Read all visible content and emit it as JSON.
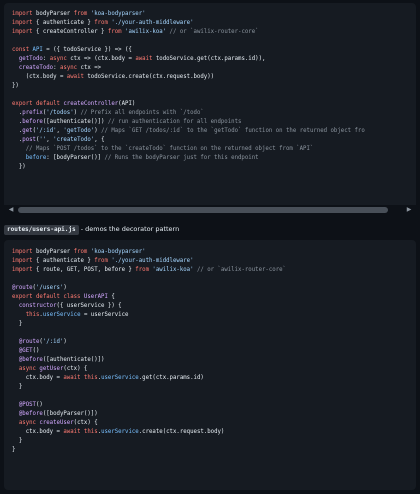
{
  "block1": {
    "lines": [
      [
        [
          "k",
          "import "
        ],
        [
          "t",
          "bodyParser "
        ],
        [
          "k",
          "from "
        ],
        [
          "s",
          "'koa-bodyparser'"
        ]
      ],
      [
        [
          "k",
          "import "
        ],
        [
          "t",
          "{ authenticate } "
        ],
        [
          "k",
          "from "
        ],
        [
          "s",
          "'./your-auth-middleware'"
        ]
      ],
      [
        [
          "k",
          "import "
        ],
        [
          "t",
          "{ createController } "
        ],
        [
          "k",
          "from "
        ],
        [
          "s",
          "'awilix-koa' "
        ],
        [
          "c",
          "// or `awilix-router-core`"
        ]
      ],
      [],
      [
        [
          "k",
          "const "
        ],
        [
          "p",
          "API "
        ],
        [
          "t",
          "= ({ todoService }) => ({"
        ]
      ],
      [
        [
          "t",
          "  "
        ],
        [
          "f",
          "getTodo"
        ],
        [
          "t",
          ": "
        ],
        [
          "k",
          "async "
        ],
        [
          "t",
          "ctx => (ctx.body = "
        ],
        [
          "k",
          "await "
        ],
        [
          "t",
          "todoService.get(ctx.params.id)),"
        ]
      ],
      [
        [
          "t",
          "  "
        ],
        [
          "f",
          "createTodo"
        ],
        [
          "t",
          ": "
        ],
        [
          "k",
          "async "
        ],
        [
          "t",
          "ctx =>"
        ]
      ],
      [
        [
          "t",
          "    (ctx.body = "
        ],
        [
          "k",
          "await "
        ],
        [
          "t",
          "todoService.create(ctx.request.body))"
        ]
      ],
      [
        [
          "t",
          "})"
        ]
      ],
      [],
      [
        [
          "k",
          "export default "
        ],
        [
          "f",
          "createController"
        ],
        [
          "t",
          "(API)"
        ]
      ],
      [
        [
          "t",
          "  ."
        ],
        [
          "f",
          "prefix"
        ],
        [
          "t",
          "("
        ],
        [
          "s",
          "'/todos'"
        ],
        [
          "t",
          ") "
        ],
        [
          "c",
          "// Prefix all endpoints with `/todo`"
        ]
      ],
      [
        [
          "t",
          "  ."
        ],
        [
          "f",
          "before"
        ],
        [
          "t",
          "([authenticate()]) "
        ],
        [
          "c",
          "// run authentication for all endpoints"
        ]
      ],
      [
        [
          "t",
          "  ."
        ],
        [
          "f",
          "get"
        ],
        [
          "t",
          "("
        ],
        [
          "s",
          "'/:id'"
        ],
        [
          "t",
          ", "
        ],
        [
          "s",
          "'getTodo'"
        ],
        [
          "t",
          ") "
        ],
        [
          "c",
          "// Maps `GET /todos/:id` to the `getTodo` function on the returned object fro"
        ]
      ],
      [
        [
          "t",
          "  ."
        ],
        [
          "f",
          "post"
        ],
        [
          "t",
          "("
        ],
        [
          "s",
          "''"
        ],
        [
          "t",
          ", "
        ],
        [
          "s",
          "'createTodo'"
        ],
        [
          "t",
          ", {"
        ]
      ],
      [
        [
          "t",
          "    "
        ],
        [
          "c",
          "// Maps `POST /todos` to the `createTodo` function on the returned object from `API`"
        ]
      ],
      [
        [
          "t",
          "    "
        ],
        [
          "p",
          "before"
        ],
        [
          "t",
          ": [bodyParser()] "
        ],
        [
          "c",
          "// Runs the bodyParser just for this endpoint"
        ]
      ],
      [
        [
          "t",
          "  })"
        ]
      ]
    ]
  },
  "caption": {
    "file": "routes/users-api.js",
    "text": " - demos the decorator pattern"
  },
  "block2": {
    "lines": [
      [
        [
          "k",
          "import "
        ],
        [
          "t",
          "bodyParser "
        ],
        [
          "k",
          "from "
        ],
        [
          "s",
          "'koa-bodyparser'"
        ]
      ],
      [
        [
          "k",
          "import "
        ],
        [
          "t",
          "{ authenticate } "
        ],
        [
          "k",
          "from "
        ],
        [
          "s",
          "'./your-auth-middleware'"
        ]
      ],
      [
        [
          "k",
          "import "
        ],
        [
          "t",
          "{ route, GET, POST, before } "
        ],
        [
          "k",
          "from "
        ],
        [
          "s",
          "'awilix-koa' "
        ],
        [
          "c",
          "// or `awilix-router-core`"
        ]
      ],
      [],
      [
        [
          "f",
          "@route"
        ],
        [
          "t",
          "("
        ],
        [
          "s",
          "'/users'"
        ],
        [
          "t",
          ")"
        ]
      ],
      [
        [
          "k",
          "export default class "
        ],
        [
          "f",
          "UserAPI "
        ],
        [
          "t",
          "{"
        ]
      ],
      [
        [
          "t",
          "  "
        ],
        [
          "f",
          "constructor"
        ],
        [
          "t",
          "({ userService }) {"
        ]
      ],
      [
        [
          "t",
          "    "
        ],
        [
          "k",
          "this"
        ],
        [
          "t",
          "."
        ],
        [
          "p",
          "userService "
        ],
        [
          "t",
          "= userService"
        ]
      ],
      [
        [
          "t",
          "  }"
        ]
      ],
      [],
      [
        [
          "t",
          "  "
        ],
        [
          "f",
          "@route"
        ],
        [
          "t",
          "("
        ],
        [
          "s",
          "'/:id'"
        ],
        [
          "t",
          ")"
        ]
      ],
      [
        [
          "t",
          "  "
        ],
        [
          "f",
          "@GET"
        ],
        [
          "t",
          "()"
        ]
      ],
      [
        [
          "t",
          "  "
        ],
        [
          "f",
          "@before"
        ],
        [
          "t",
          "([authenticate()])"
        ]
      ],
      [
        [
          "t",
          "  "
        ],
        [
          "k",
          "async "
        ],
        [
          "f",
          "getUser"
        ],
        [
          "t",
          "(ctx) {"
        ]
      ],
      [
        [
          "t",
          "    ctx.body = "
        ],
        [
          "k",
          "await this"
        ],
        [
          "t",
          "."
        ],
        [
          "p",
          "userService"
        ],
        [
          "t",
          ".get(ctx.params.id)"
        ]
      ],
      [
        [
          "t",
          "  }"
        ]
      ],
      [],
      [
        [
          "t",
          "  "
        ],
        [
          "f",
          "@POST"
        ],
        [
          "t",
          "()"
        ]
      ],
      [
        [
          "t",
          "  "
        ],
        [
          "f",
          "@before"
        ],
        [
          "t",
          "([bodyParser()])"
        ]
      ],
      [
        [
          "t",
          "  "
        ],
        [
          "k",
          "async "
        ],
        [
          "f",
          "createUser"
        ],
        [
          "t",
          "(ctx) {"
        ]
      ],
      [
        [
          "t",
          "    ctx.body = "
        ],
        [
          "k",
          "await this"
        ],
        [
          "t",
          "."
        ],
        [
          "p",
          "userService"
        ],
        [
          "t",
          ".create(ctx.request.body)"
        ]
      ],
      [
        [
          "t",
          "  }"
        ]
      ],
      [
        [
          "t",
          "}"
        ]
      ]
    ]
  },
  "scrollbar": {
    "left_arrow": "◀",
    "right_arrow": "▶"
  },
  "colors": {
    "background": "#0d1117",
    "code_background": "#161b22",
    "keyword": "#ff7b72",
    "string": "#a5d6ff",
    "function": "#d2a8ff",
    "property": "#79c0ff",
    "comment": "#8b949e"
  }
}
